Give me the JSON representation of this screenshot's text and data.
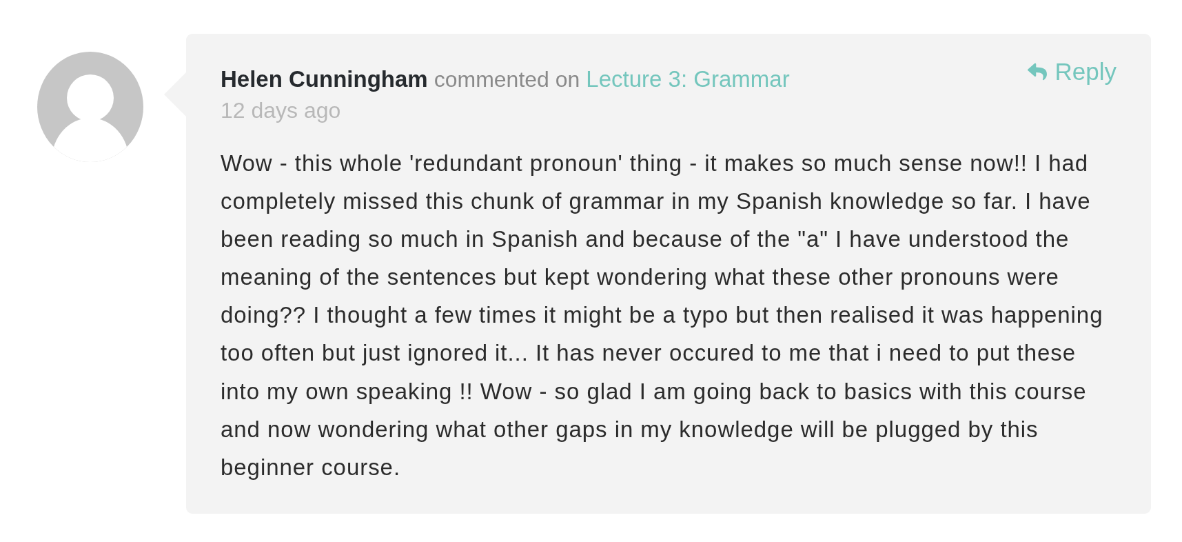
{
  "comment": {
    "author": "Helen Cunningham",
    "action": "commented on",
    "target": "Lecture 3: Grammar",
    "time": "12 days ago",
    "reply_label": "Reply",
    "body": "Wow - this whole 'redundant pronoun' thing - it makes so much sense now!! I had completely missed this chunk of grammar in my Spanish knowledge so far. I have been reading so much in Spanish and because of the \"a\" I have understood the meaning of the sentences but kept wondering what these other pronouns were doing?? I thought a few times it might be a typo but then realised it was happening too often but just ignored it... It has never occured to me that i need to put these into my own speaking !! Wow - so glad I am going back to basics with this course and now wondering what other gaps in my knowledge will be plugged by this beginner course."
  }
}
